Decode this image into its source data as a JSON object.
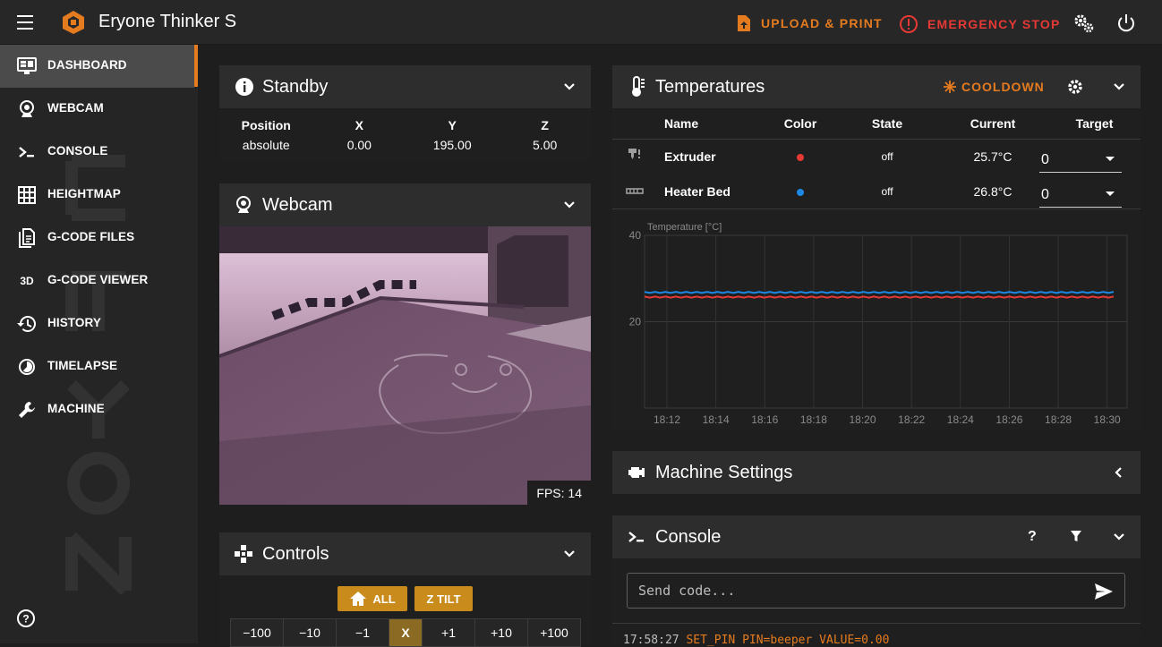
{
  "app": {
    "title": "Eryone Thinker S",
    "accent": "#e57b1f",
    "danger": "#e53935"
  },
  "topbar": {
    "upload_label": "UPLOAD & PRINT",
    "emergency_label": "EMERGENCY STOP",
    "icons": [
      "menu-icon",
      "logo-icon",
      "upload-icon",
      "emergency-icon",
      "settings-icon",
      "power-icon"
    ]
  },
  "sidebar": {
    "items": [
      {
        "label": "DASHBOARD",
        "icon": "monitor-icon",
        "active": true
      },
      {
        "label": "WEBCAM",
        "icon": "webcam-icon"
      },
      {
        "label": "CONSOLE",
        "icon": "console-icon"
      },
      {
        "label": "HEIGHTMAP",
        "icon": "grid-icon"
      },
      {
        "label": "G-CODE FILES",
        "icon": "files-icon"
      },
      {
        "label": "G-CODE VIEWER",
        "icon": "3d-icon",
        "icon_text": "3D"
      },
      {
        "label": "HISTORY",
        "icon": "history-icon"
      },
      {
        "label": "TIMELAPSE",
        "icon": "timelapse-icon"
      },
      {
        "label": "MACHINE",
        "icon": "wrench-icon"
      }
    ]
  },
  "standby": {
    "title": "Standby",
    "headers": [
      "Position",
      "X",
      "Y",
      "Z"
    ],
    "values": [
      "absolute",
      "0.00",
      "195.00",
      "5.00"
    ]
  },
  "webcam": {
    "title": "Webcam",
    "fps": "FPS: 14"
  },
  "controls": {
    "title": "Controls",
    "home_all": "ALL",
    "z_tilt": "Z TILT",
    "jog_minus": [
      "−100",
      "−10",
      "−1"
    ],
    "axis": "X",
    "jog_plus": [
      "+1",
      "+10",
      "+100"
    ]
  },
  "temperatures": {
    "title": "Temperatures",
    "cooldown": "COOLDOWN",
    "headers": [
      "Name",
      "Color",
      "State",
      "Current",
      "Target"
    ],
    "rows": [
      {
        "name": "Extruder",
        "color": "#e53935",
        "state": "off",
        "current": "25.7°C",
        "target": "0"
      },
      {
        "name": "Heater Bed",
        "color": "#1e88e5",
        "state": "off",
        "current": "26.8°C",
        "target": "0"
      }
    ]
  },
  "chart_data": {
    "type": "line",
    "ylabel": "Temperature [°C]",
    "ylim": [
      0,
      40
    ],
    "yticks": [
      "40",
      "20"
    ],
    "x": [
      "18:12",
      "18:14",
      "18:16",
      "18:18",
      "18:20",
      "18:22",
      "18:24",
      "18:26",
      "18:28",
      "18:30"
    ],
    "series": [
      {
        "name": "Heater Bed",
        "color": "#1e88e5",
        "values": [
          26.8,
          26.8,
          26.8,
          26.8,
          26.8,
          26.8,
          26.8,
          26.8,
          26.8,
          26.8
        ]
      },
      {
        "name": "Extruder",
        "color": "#e53935",
        "values": [
          25.7,
          25.7,
          25.7,
          25.7,
          25.7,
          25.7,
          25.7,
          25.7,
          25.7,
          25.7
        ]
      }
    ],
    "grid": true
  },
  "machine_settings": {
    "title": "Machine Settings"
  },
  "console": {
    "title": "Console",
    "help": "?",
    "placeholder": "Send code...",
    "log_time": "17:58:27",
    "log_cmd": "SET_PIN PIN=beeper VALUE=0.00"
  }
}
